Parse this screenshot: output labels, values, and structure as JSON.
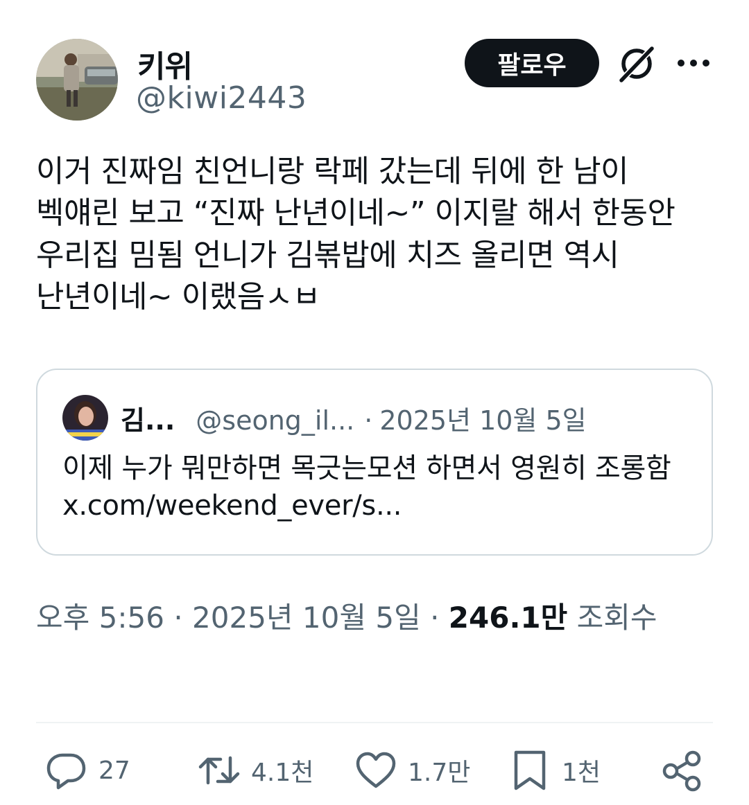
{
  "author": {
    "display_name": "키위",
    "handle": "@kiwi2443",
    "follow_label": "팔로우"
  },
  "tweet": {
    "text": "이거 진짜임 친언니랑 락페 갔는데 뒤에 한 남이 벡얘린 보고 “진짜 난년이네~” 이지랄 해서 한동안 우리집 밈됨 언니가 김볶밥에 치즈 올리면 역시 난년이네~ 이랬음ㅅㅂ"
  },
  "quote": {
    "name": "김...",
    "handle": "@seong_il...",
    "separator": "·",
    "date": "2025년 10월 5일",
    "text": "이제 누가 뭐만하면 목긋는모션 하면서 영원히 조롱함 x.com/weekend_ever/s..."
  },
  "meta": {
    "time": "오후 5:56",
    "separator": "·",
    "date": "2025년 10월 5일",
    "views_count": "246.1만",
    "views_label": "조회수"
  },
  "actions": {
    "reply_count": "27",
    "retweet_count": "4.1천",
    "like_count": "1.7만",
    "bookmark_count": "1천"
  },
  "icons": {
    "grok": "grok-icon",
    "more": "more-icon",
    "reply": "reply-icon",
    "retweet": "retweet-icon",
    "like": "heart-icon",
    "bookmark": "bookmark-icon",
    "share": "share-icon"
  },
  "colors": {
    "text_primary": "#0f1419",
    "text_secondary": "#536471",
    "border": "#cfd9de",
    "follow_bg": "#0f1419"
  }
}
